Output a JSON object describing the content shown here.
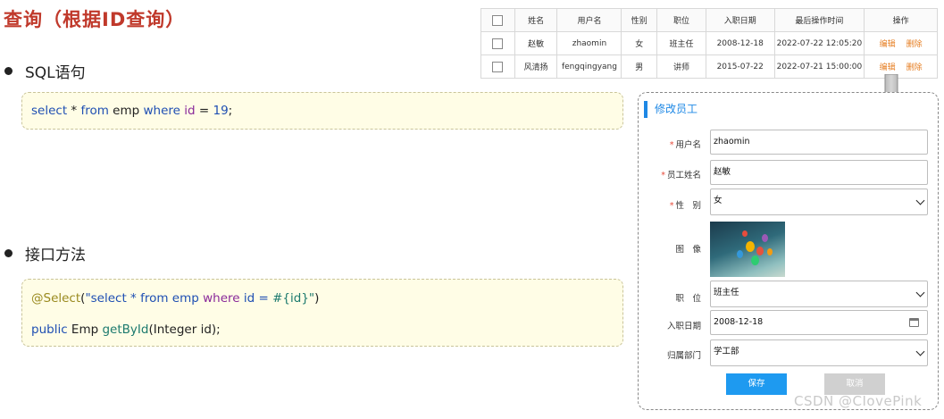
{
  "page": {
    "title": "查询（根据ID查询）",
    "watermark": "CSDN @CIovePink"
  },
  "sections": {
    "sql": {
      "label": "SQL语句"
    },
    "api": {
      "label": "接口方法"
    }
  },
  "sql_code": {
    "kw_select": "select",
    "star": " * ",
    "kw_from": "from",
    "table": " emp ",
    "kw_where": "where",
    "col": " id ",
    "eq": "= ",
    "value": "19",
    "semi": ";"
  },
  "api_code": {
    "annotation": "@Select",
    "paren_open": "(",
    "str_a": "\"select * from emp ",
    "str_b": "where",
    "str_c": " id = ",
    "str_d": "#{id}\"",
    "paren_close": ")",
    "kw_public": "public",
    "ret_type": " Emp ",
    "method": "getById",
    "params": "(Integer id);"
  },
  "table": {
    "headers": [
      "姓名",
      "用户名",
      "性别",
      "职位",
      "入职日期",
      "最后操作时间",
      "操作"
    ],
    "rows": [
      {
        "name": "赵敏",
        "username": "zhaomin",
        "gender": "女",
        "job": "班主任",
        "entry_date": "2008-12-18",
        "update_time": "2022-07-22 12:05:20"
      },
      {
        "name": "风清扬",
        "username": "fengqingyang",
        "gender": "男",
        "job": "讲师",
        "entry_date": "2015-07-22",
        "update_time": "2022-07-21 15:00:00"
      }
    ],
    "edit_label": "编辑",
    "delete_label": "删除"
  },
  "form": {
    "title": "修改员工",
    "required_mark": "*",
    "username_label": "用户名",
    "username_value": "zhaomin",
    "name_label": "员工姓名",
    "name_value": "赵敏",
    "gender_label": "性　别",
    "gender_value": "女",
    "avatar_label": "图　像",
    "job_label": "职　位",
    "job_value": "班主任",
    "entry_label": "入职日期",
    "entry_value": "2008-12-18",
    "dept_label": "归属部门",
    "dept_value": "学工部",
    "save_label": "保存",
    "cancel_label": "取消"
  },
  "colors": {
    "title": "#c0392b",
    "accent": "#1e88e5",
    "save_button": "#1e9af0",
    "link": "#e67e22",
    "code_bg": "#fffde6"
  }
}
